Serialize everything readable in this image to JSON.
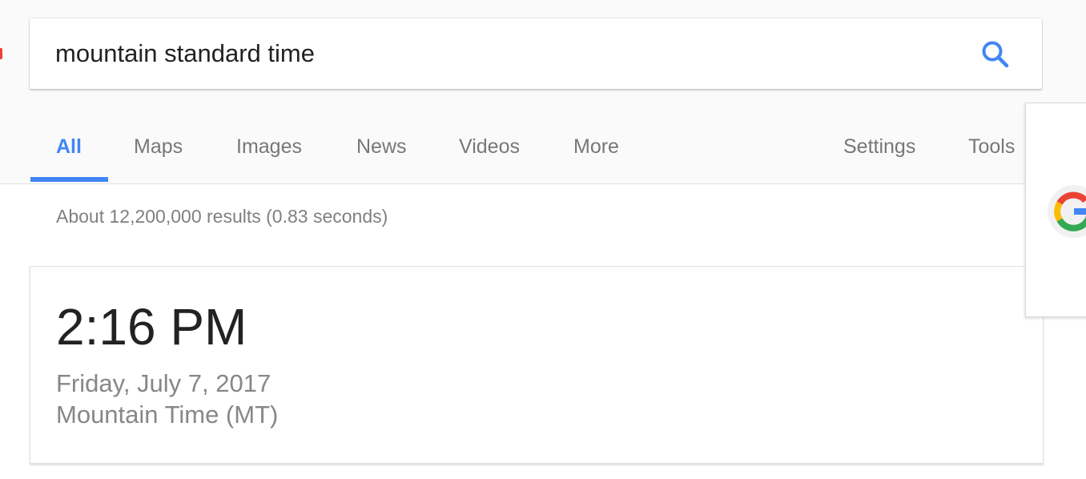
{
  "search": {
    "query": "mountain standard time"
  },
  "tabs": [
    {
      "label": "All",
      "active": true
    },
    {
      "label": "Maps"
    },
    {
      "label": "Images"
    },
    {
      "label": "News"
    },
    {
      "label": "Videos"
    },
    {
      "label": "More"
    }
  ],
  "tools": {
    "settings_label": "Settings",
    "tools_label": "Tools"
  },
  "results": {
    "stats": "About 12,200,000 results (0.83 seconds)"
  },
  "time_card": {
    "time": "2:16 PM",
    "date": "Friday, July 7, 2017",
    "zone": "Mountain Time (MT)"
  },
  "side_panel": {
    "icon": "google-g-icon"
  },
  "colors": {
    "accent": "#4285f4",
    "google_red": "#ea4335",
    "google_yellow": "#fbbc05",
    "google_green": "#34a853",
    "muted_text": "#878787"
  }
}
